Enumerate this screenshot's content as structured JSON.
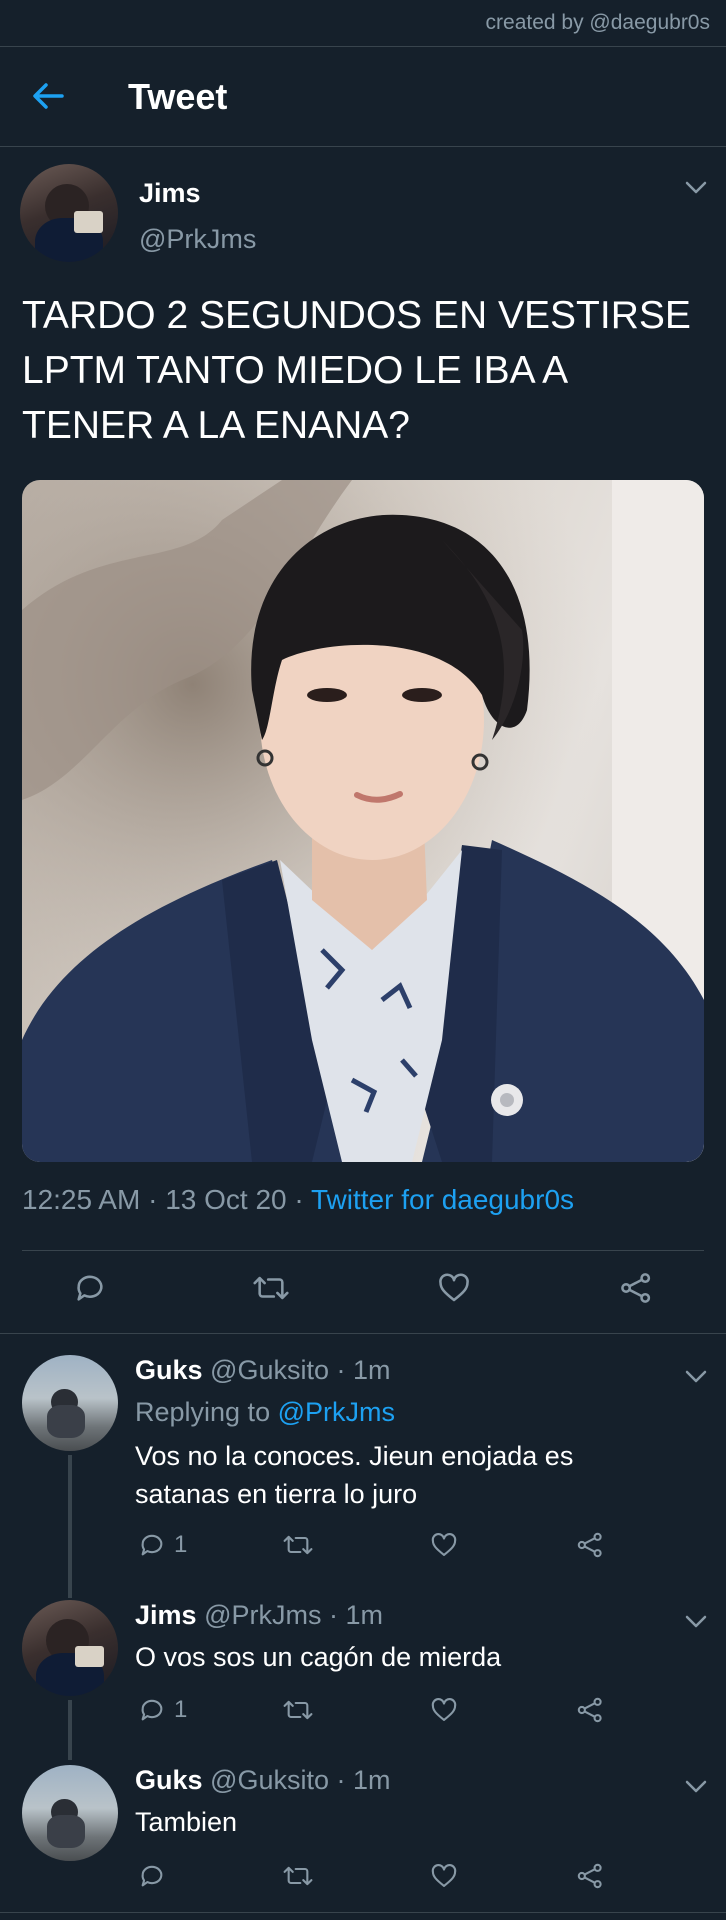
{
  "watermark": "created by @daegubr0s",
  "header": {
    "title": "Tweet"
  },
  "tweet": {
    "name": "Jims",
    "handle": "@PrkJms",
    "text_lines": [
      "TARDO 2 SEGUNDOS EN VESTIRSE",
      "LPTM TANTO MIEDO LE IBA A",
      "TENER A LA ENANA?"
    ],
    "time": "12:25 AM",
    "sep1": " · ",
    "date": "13 Oct 20",
    "sep2": " · ",
    "source": "Twitter for daegubr0s"
  },
  "replies": [
    {
      "name": "Guks",
      "handle": "@Guksito",
      "time": "· 1m",
      "replying_prefix": "Replying to ",
      "replying_to": "@PrkJms",
      "text_lines": [
        "Vos no la conoces. Jieun enojada es",
        "satanas en tierra lo juro"
      ],
      "reply_count": "1"
    },
    {
      "name": "Jims",
      "handle": "@PrkJms",
      "time": "· 1m",
      "text_lines": [
        "O vos sos un cagón de mierda"
      ],
      "reply_count": "1"
    },
    {
      "name": "Guks",
      "handle": "@Guksito",
      "time": "· 1m",
      "text_lines": [
        "Tambien"
      ],
      "reply_count": ""
    }
  ],
  "colors": {
    "background": "#15202b",
    "accent": "#1da1f2",
    "secondary_text": "#8899a6",
    "divider": "#38444d"
  },
  "icons": [
    "back-arrow-icon",
    "chevron-down-icon",
    "reply-icon",
    "retweet-icon",
    "like-icon",
    "share-icon"
  ]
}
